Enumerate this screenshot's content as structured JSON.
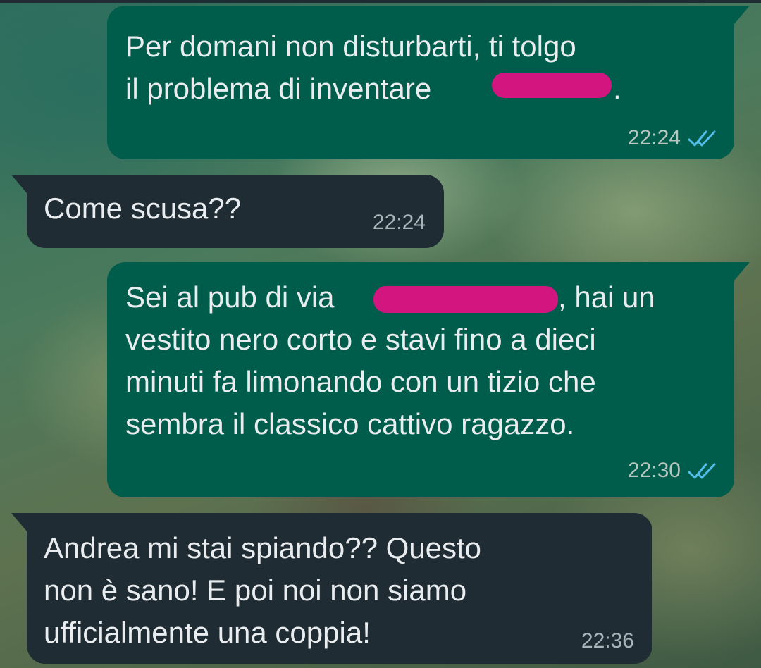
{
  "colors": {
    "outgoing_bubble": "#005c4b",
    "incoming_bubble": "#1f2c33",
    "text": "#e9edef",
    "read_ticks": "#53bdeb",
    "redaction": "#d3157f"
  },
  "messages": [
    {
      "direction": "outgoing",
      "text": "Per domani non disturbarti, ti tolgo\nil problema di inventare",
      "redacted": true,
      "text_after_redaction": ".",
      "time": "22:24",
      "status_icon": "double-check-read-icon"
    },
    {
      "direction": "incoming",
      "text": "Come scusa??",
      "time": "22:24"
    },
    {
      "direction": "outgoing",
      "text_before_redaction": "Sei al pub di via",
      "redacted": true,
      "text_after_redaction": ", hai un",
      "text": "vestito nero corto e stavi fino a dieci\nminuti fa limonando con un tizio che\nsembra il classico cattivo ragazzo.",
      "time": "22:30",
      "status_icon": "double-check-read-icon"
    },
    {
      "direction": "incoming",
      "text": "Andrea mi stai spiando?? Questo\nnon è sano! E poi noi non siamo\nufficialmente una coppia!",
      "time": "22:36"
    }
  ]
}
